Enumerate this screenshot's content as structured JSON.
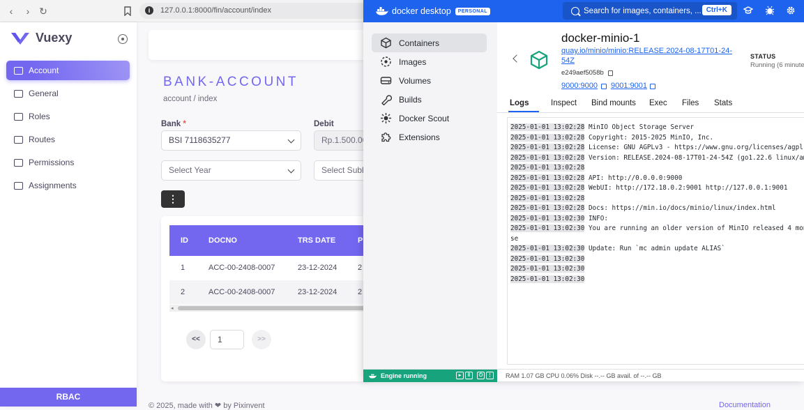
{
  "browser": {
    "url": "127.0.0.1:8000/fin/account/index",
    "back_glyph": "‹",
    "forward_glyph": "›",
    "reload_glyph": "↻"
  },
  "app": {
    "brand": "Vuexy",
    "brand_color": "#7367f0",
    "menu": [
      {
        "label": "Account",
        "active": true
      },
      {
        "label": "General"
      },
      {
        "label": "Roles"
      },
      {
        "label": "Routes"
      },
      {
        "label": "Permissions"
      },
      {
        "label": "Assignments"
      }
    ],
    "sidebar_footer": "RBAC"
  },
  "page": {
    "title": "BANK-ACCOUNT",
    "breadcrumb": "account / index",
    "bank_label": "Bank",
    "required_mark": "*",
    "bank_value": "BSI 7118635277",
    "debit_label": "Debit",
    "debit_value": "Rp.1.500.00",
    "year_placeholder": "Select Year",
    "subledger_placeholder": "Select Subl",
    "more_glyph": "⋮",
    "table": {
      "headers": [
        "ID",
        "DOCNO",
        "TRS DATE",
        "P"
      ],
      "rows": [
        [
          "1",
          "ACC-00-2408-0007",
          "23-12-2024",
          "2"
        ],
        [
          "2",
          "ACC-00-2408-0007",
          "23-12-2024",
          "2"
        ]
      ],
      "scroll_arrow": "◂"
    },
    "pagination": {
      "prev": "<<",
      "page": "1",
      "next": ">>"
    },
    "footer_left": "© 2025, made with ❤ by Pixinvent",
    "footer_right": "Documentation"
  },
  "docker": {
    "brand": "docker desktop",
    "plan_badge": "PERSONAL",
    "brand_color": "#1d63ed",
    "search_placeholder": "Search for images, containers, ...",
    "search_shortcut": "Ctrl+K",
    "nav": [
      {
        "label": "Containers",
        "icon": "container-icon",
        "active": true
      },
      {
        "label": "Images",
        "icon": "images-icon"
      },
      {
        "label": "Volumes",
        "icon": "volumes-icon"
      },
      {
        "label": "Builds",
        "icon": "builds-icon"
      },
      {
        "label": "Docker Scout",
        "icon": "scout-icon"
      },
      {
        "label": "Extensions",
        "icon": "extensions-icon"
      }
    ],
    "engine_status": "Engine running",
    "resource_stats": "RAM 1.07 GB   CPU 0.06%      Disk --.-- GB avail. of --.-- GB",
    "container": {
      "name": "docker-minio-1",
      "image": "quay.io/minio/minio:RELEASE.2024-08-17T01-24-54Z",
      "hash": "e249aef5058b",
      "ports": [
        "9000:9000",
        "9001:9001"
      ],
      "status_label": "STATUS",
      "status_value": "Running (6 minute"
    },
    "tabs": [
      "Logs",
      "Inspect",
      "Bind mounts",
      "Exec",
      "Files",
      "Stats"
    ],
    "logs": [
      {
        "ts": "2025-01-01 13:02:28",
        "msg": " MinIO Object Storage Server"
      },
      {
        "ts": "2025-01-01 13:02:28",
        "msg": " Copyright: 2015-2025 MinIO, Inc."
      },
      {
        "ts": "2025-01-01 13:02:28",
        "msg": " License: GNU AGPLv3 - https://www.gnu.org/licenses/agpl-3."
      },
      {
        "ts": "2025-01-01 13:02:28",
        "msg": " Version: RELEASE.2024-08-17T01-24-54Z (go1.22.6 linux/amd6"
      },
      {
        "ts": "2025-01-01 13:02:28",
        "msg": ""
      },
      {
        "ts": "2025-01-01 13:02:28",
        "msg": " API: http://0.0.0.0:9000"
      },
      {
        "ts": "2025-01-01 13:02:28",
        "msg": " WebUI: http://172.18.0.2:9001 http://127.0.0.1:9001"
      },
      {
        "ts": "2025-01-01 13:02:28",
        "msg": ""
      },
      {
        "ts": "2025-01-01 13:02:28",
        "msg": " Docs: https://min.io/docs/minio/linux/index.html"
      },
      {
        "ts": "2025-01-01 13:02:30",
        "msg": " INFO:"
      },
      {
        "ts": "2025-01-01 13:02:30",
        "msg": "  You are running an older version of MinIO released 4 mont"
      },
      {
        "ts": "",
        "msg": "se"
      },
      {
        "ts": "2025-01-01 13:02:30",
        "msg": "  Update: Run `mc admin update ALIAS`"
      },
      {
        "ts": "2025-01-01 13:02:30",
        "msg": ""
      },
      {
        "ts": "2025-01-01 13:02:30",
        "msg": ""
      },
      {
        "ts": "2025-01-01 13:02:30",
        "msg": ""
      }
    ]
  }
}
